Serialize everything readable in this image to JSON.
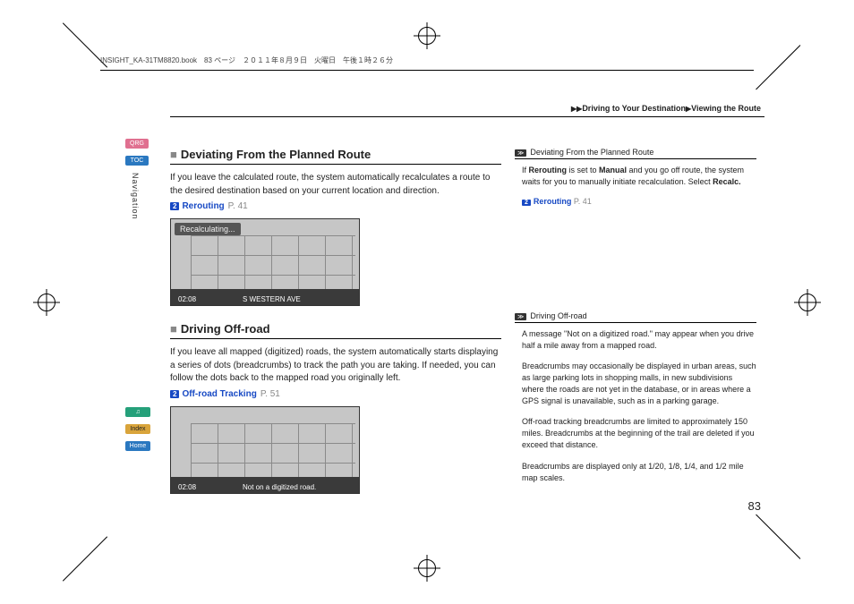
{
  "printer_header": "INSIGHT_KA-31TM8820.book　83 ページ　２０１１年８月９日　火曜日　午後１時２６分",
  "breadcrumb": {
    "a": "Driving to Your Destination",
    "b": "Viewing the Route"
  },
  "side_tabs": {
    "qrg": "QRG",
    "toc": "TOC",
    "nav": "Navigation",
    "voice": "",
    "index": "Index",
    "home": "Home"
  },
  "section1": {
    "heading": "Deviating From the Planned Route",
    "body": "If you leave the calculated route, the system automatically recalculates a route to the desired destination based on your current location and direction.",
    "xref_label": "Rerouting",
    "xref_page": "P. 41",
    "map_banner": "Recalculating...",
    "map_time": "02:08",
    "map_street": "S WESTERN AVE"
  },
  "section2": {
    "heading": "Driving Off-road",
    "body": "If you leave all mapped (digitized) roads, the system automatically starts displaying a series of dots (breadcrumbs) to track the path you are taking. If needed, you can follow the dots back to the mapped road you originally left.",
    "xref_label": "Off-road Tracking",
    "xref_page": "P. 51",
    "map_time": "02:08",
    "map_msg": "Not on a digitized road."
  },
  "side1": {
    "heading": "Deviating From the Planned Route",
    "body_a": "If ",
    "body_b": "Rerouting",
    "body_c": " is set to ",
    "body_d": "Manual",
    "body_e": " and you go off route, the system waits for you to manually initiate recalculation. Select ",
    "body_f": "Recalc.",
    "xref_label": "Rerouting",
    "xref_page": "P. 41"
  },
  "side2": {
    "heading": "Driving Off-road",
    "p1": "A message \"Not on a digitized road.\" may appear when you drive half a mile away from a mapped road.",
    "p2": "Breadcrumbs may occasionally be displayed in urban areas, such as large parking lots in shopping malls, in new subdivisions where the roads are not yet in the database, or in areas where a GPS signal is unavailable, such as in a parking garage.",
    "p3": "Off-road tracking breadcrumbs are limited to approximately 150 miles. Breadcrumbs at the beginning of the trail are deleted if you exceed that distance.",
    "p4": "Breadcrumbs are displayed only at 1/20, 1/8, 1/4, and 1/2 mile map scales."
  },
  "page_number": "83"
}
